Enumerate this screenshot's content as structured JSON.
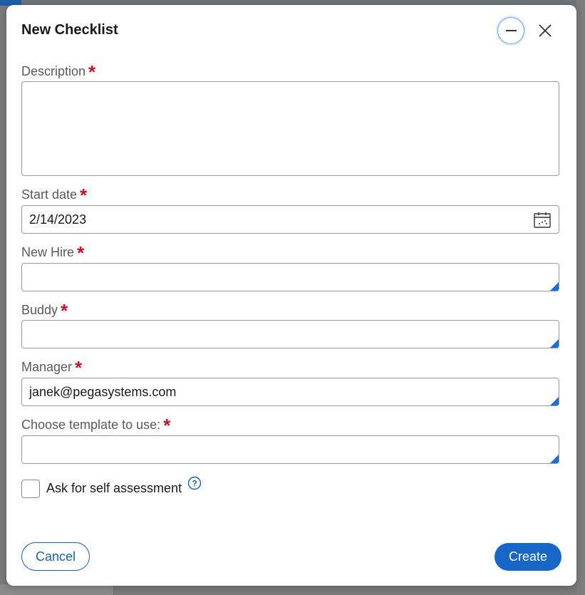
{
  "dialog": {
    "title": "New Checklist",
    "minimize_icon": "minus-icon",
    "close_icon": "close-icon"
  },
  "fields": {
    "description": {
      "label": "Description",
      "value": ""
    },
    "start_date": {
      "label": "Start date",
      "value": "2/14/2023",
      "icon": "calendar-icon"
    },
    "new_hire": {
      "label": "New Hire",
      "value": ""
    },
    "buddy": {
      "label": "Buddy",
      "value": ""
    },
    "manager": {
      "label": "Manager",
      "value": "janek@pegasystems.com"
    },
    "template": {
      "label": "Choose template to use:",
      "value": ""
    }
  },
  "required_marker": "*",
  "self_assessment": {
    "label": "Ask for self assessment",
    "checked": false,
    "help_icon": "help-icon",
    "help_glyph": "?"
  },
  "actions": {
    "cancel_label": "Cancel",
    "create_label": "Create"
  },
  "colors": {
    "accent": "#1766c8",
    "required": "#d0102a",
    "corner": "#1a6ed8"
  }
}
